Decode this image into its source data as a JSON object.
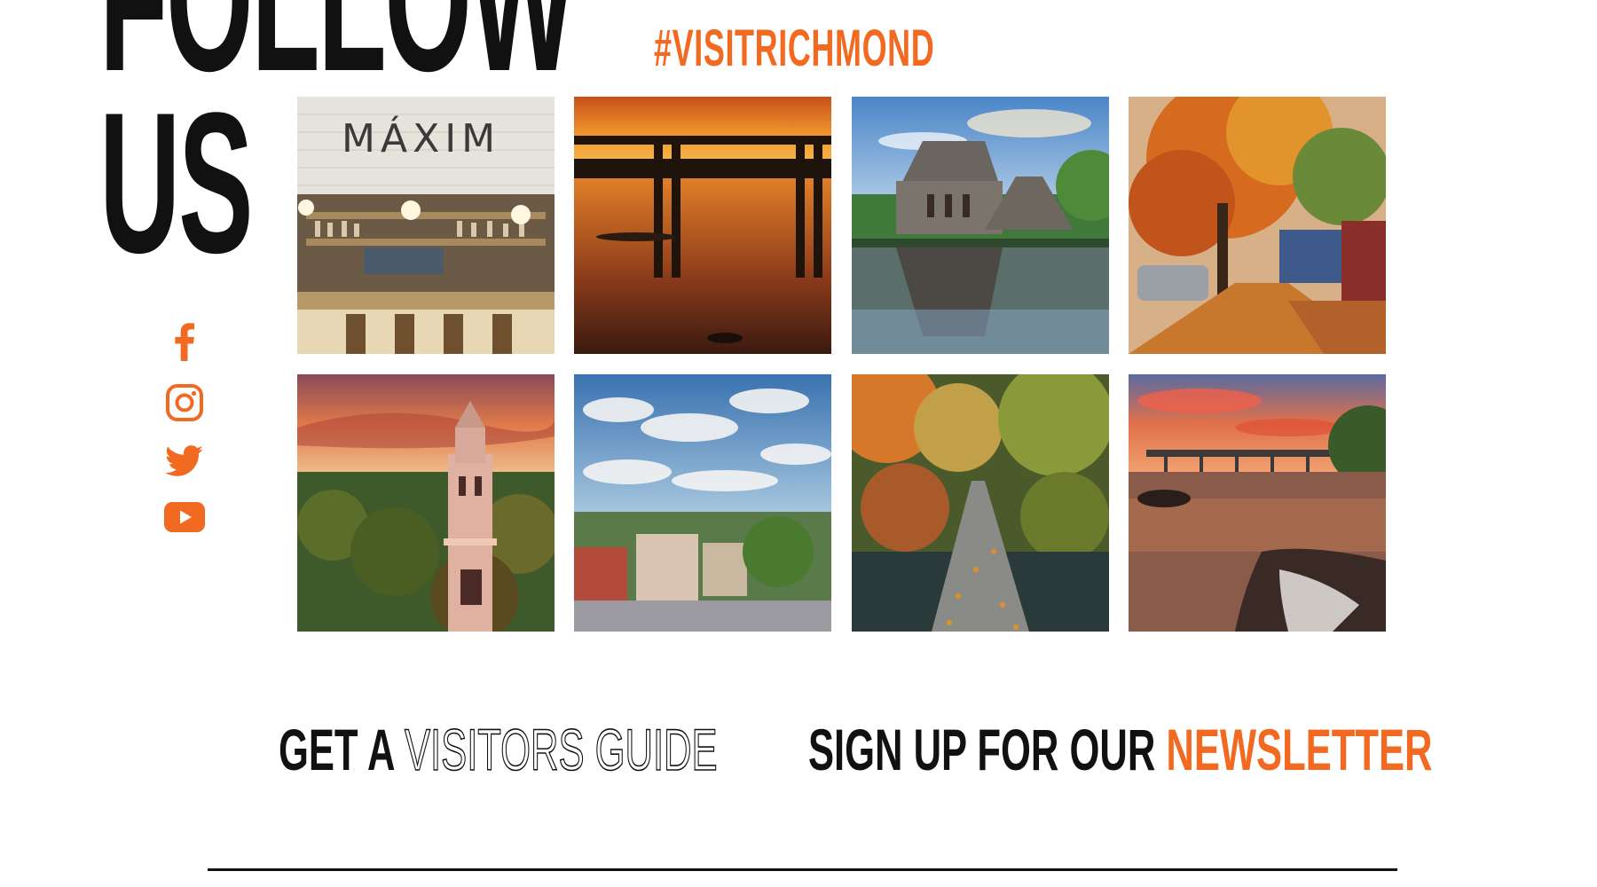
{
  "headline": {
    "line1": "FOLLOW",
    "line2": "US"
  },
  "hashtag": "#VISITRICHMOND",
  "social": [
    {
      "name": "facebook",
      "icon": "facebook-icon"
    },
    {
      "name": "instagram",
      "icon": "instagram-icon"
    },
    {
      "name": "twitter",
      "icon": "twitter-icon"
    },
    {
      "name": "youtube",
      "icon": "youtube-icon"
    }
  ],
  "photos": [
    {
      "subject": "restaurant-bar"
    },
    {
      "subject": "bridge-sunset-river"
    },
    {
      "subject": "stone-church-reflection"
    },
    {
      "subject": "autumn-street"
    },
    {
      "subject": "bell-tower-sunset"
    },
    {
      "subject": "city-skyline-clouds"
    },
    {
      "subject": "forest-path-autumn"
    },
    {
      "subject": "river-rapids-bridge"
    }
  ],
  "cta": {
    "guide_prefix": "GET A",
    "guide_link": "VISITORS GUIDE",
    "newsletter_prefix": "SIGN UP FOR OUR",
    "newsletter_link": "NEWSLETTER"
  },
  "colors": {
    "accent": "#f26a21",
    "text": "#111111",
    "background": "#ffffff"
  }
}
